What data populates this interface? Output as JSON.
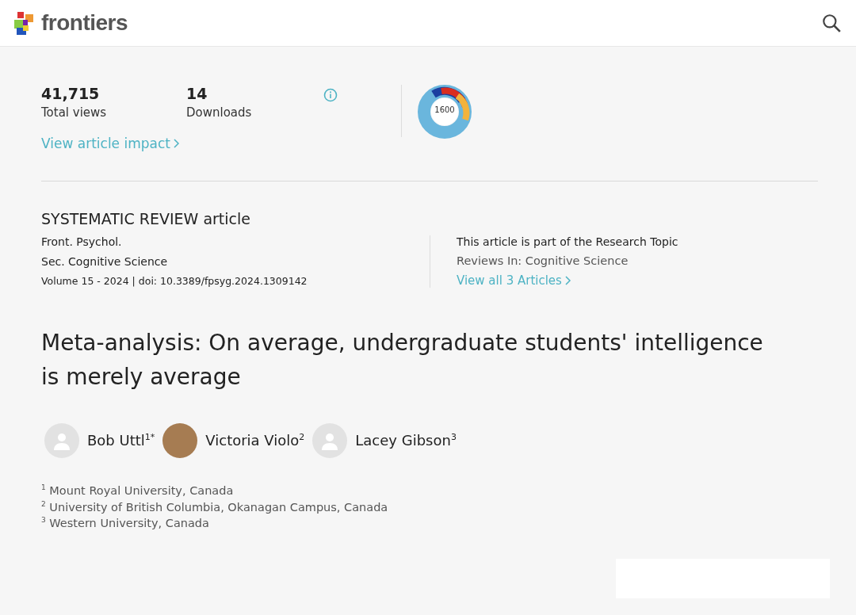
{
  "header": {
    "logo_text": "frontiers"
  },
  "metrics": [
    {
      "value": "41,715",
      "label": "Total views"
    },
    {
      "value": "14",
      "label": "Downloads"
    }
  ],
  "impact_link": "View article impact",
  "altmetric_score": "1600",
  "article_type": "SYSTEMATIC REVIEW article",
  "journal": "Front. Psychol.",
  "section": "Sec. Cognitive Science",
  "volume_doi": "Volume 15 - 2024 | doi: 10.3389/fpsyg.2024.1309142",
  "research_topic": {
    "intro": "This article is part of the Research Topic",
    "name": "Reviews In: Cognitive Science",
    "link": "View all 3 Articles"
  },
  "title": "Meta-analysis: On average, undergraduate students' intelligence is merely average",
  "authors": [
    {
      "name": "Bob Uttl$^{1*}$",
      "kind": "placeholder"
    },
    {
      "name": "Victoria Violo$^{2}$",
      "kind": "photo"
    },
    {
      "name": "Lacey Gibson$^{3}$",
      "kind": "placeholder"
    }
  ],
  "affiliations": [
    "$^{1}$ Mount Royal University, Canada",
    "$^{2}$ University of British Columbia, Okanagan Campus, Canada",
    "$^{3}$ Western University, Canada"
  ]
}
